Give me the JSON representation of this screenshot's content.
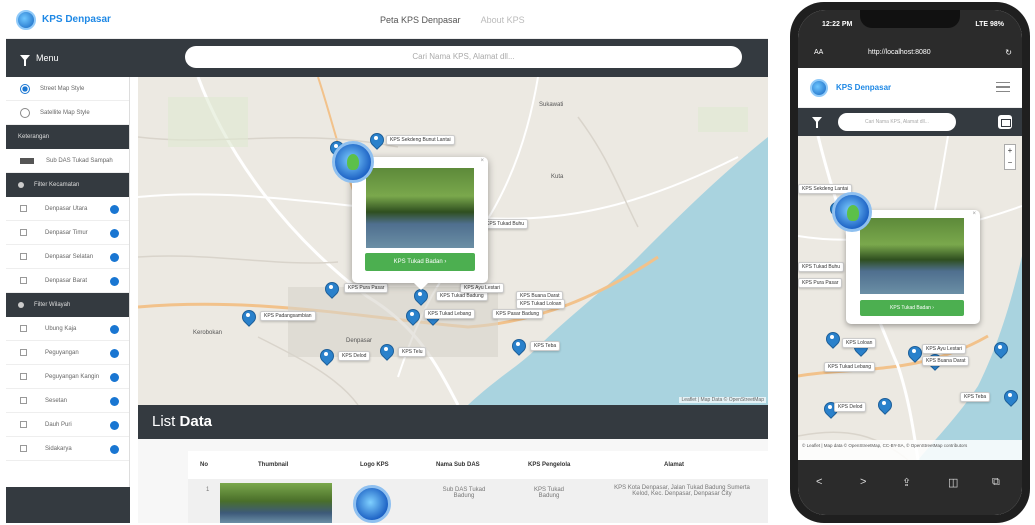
{
  "desktop": {
    "brand": "KPS Denpasar",
    "nav_links": [
      "Peta KPS Denpasar",
      "About KPS"
    ],
    "menu_label": "Menu",
    "search_placeholder": "Cari Nama KPS, Alamat dll...",
    "sidebar": {
      "basemaps": [
        "Street Map Style",
        "Satellite Map Style"
      ],
      "legend_header": "Keterangan",
      "legend_item": "Sub DAS Tukad Sampah",
      "filter_kecamatan_header": "Filter Kecamatan",
      "kecamatan": [
        "Denpasar Utara",
        "Denpasar Timur",
        "Denpasar Selatan",
        "Denpasar Barat"
      ],
      "filter_wilayah_header": "Filter Wilayah",
      "wilayah": [
        "Ubung Kaja",
        "Peguyangan",
        "Peguyangan Kangin",
        "Sesetan",
        "Dauh Puri",
        "Sidakarya"
      ]
    },
    "map": {
      "place_labels": [
        "Kuta",
        "Sukawati",
        "Kerobokan",
        "Denpasar"
      ],
      "marker_labels": [
        "KPS Sekdeng Bunut Lantai",
        "KPS Tukad Buhu",
        "KPS Padangsambian",
        "KPS Pura Pasar",
        "KPS Tukad Badung",
        "KPS Ayu Lestari",
        "KPS Buana Darat",
        "KPS Tukad Loloan",
        "KPS Tukad Lebang",
        "KPS Pasar Badung",
        "KPS Teba",
        "KPS Delod",
        "KPS Telu"
      ],
      "popup_button": "KPS Tukad Badan",
      "attribution": "Leaflet | Map Data © OpenStreetMap"
    },
    "list": {
      "title_light": "List",
      "title_bold": "Data",
      "columns": [
        "No",
        "Thumbnail",
        "Logo KPS",
        "Nama Sub DAS",
        "KPS Pengelola",
        "Alamat"
      ],
      "rows": [
        {
          "no": "1",
          "sub_das": "Sub DAS Tukad Badung",
          "pengelola": "KPS Tukad Badung",
          "alamat": "KPS Kota Denpasar, Jalan Tukad Badung Sumerta Kelod, Kec. Denpasar, Denpasar City"
        }
      ]
    }
  },
  "phone": {
    "time": "12:22 PM",
    "signal": "LTE 98%",
    "address_aa": "AA",
    "url": "http://localhost:8080",
    "brand": "KPS Denpasar",
    "search_placeholder": "Cari Nama KPS, Alamat dll...",
    "zoom_in": "+",
    "zoom_out": "−",
    "popup_button": "KPS Tukad Badan",
    "marker_labels": [
      "KPS Sekdeng Lantai",
      "KPS Tukad Buhu",
      "KPS Pura Pasar",
      "KPS Loloan",
      "KPS Ayu Lestari",
      "KPS Tukad Lebang",
      "KPS Buana Darat",
      "KPS Teba",
      "KPS Delod"
    ],
    "attribution": "© Leaflet | Map data © OpenStreetMap, CC-BY-SA, © OpenStreetMap contributors",
    "bottom_icons": [
      "<",
      ">",
      "⇪",
      "◫",
      "⧉"
    ]
  },
  "colors": {
    "brand": "#1e88e5",
    "dark_bar": "#343a40",
    "marker": "#2a81cb",
    "sea": "#a9d3df",
    "button": "#4caf50"
  }
}
